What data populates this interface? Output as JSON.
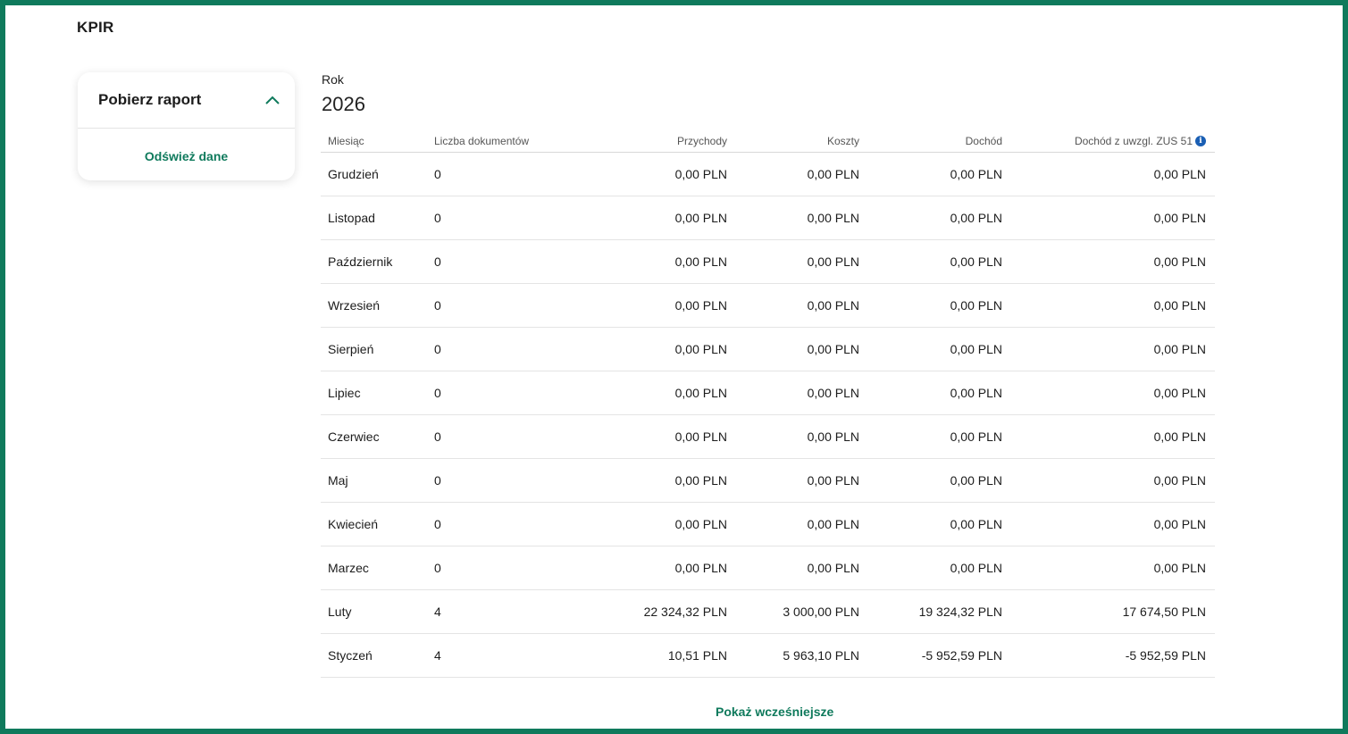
{
  "page": {
    "title": "KPIR"
  },
  "report_card": {
    "title": "Pobierz raport",
    "refresh_label": "Odśwież dane"
  },
  "year": {
    "label": "Rok",
    "value": "2026"
  },
  "table": {
    "headers": [
      "Miesiąc",
      "Liczba dokumentów",
      "Przychody",
      "Koszty",
      "Dochód",
      "Dochód z uwzgl. ZUS 51"
    ],
    "rows": [
      [
        "Grudzień",
        "0",
        "0,00 PLN",
        "0,00 PLN",
        "0,00 PLN",
        "0,00 PLN"
      ],
      [
        "Listopad",
        "0",
        "0,00 PLN",
        "0,00 PLN",
        "0,00 PLN",
        "0,00 PLN"
      ],
      [
        "Październik",
        "0",
        "0,00 PLN",
        "0,00 PLN",
        "0,00 PLN",
        "0,00 PLN"
      ],
      [
        "Wrzesień",
        "0",
        "0,00 PLN",
        "0,00 PLN",
        "0,00 PLN",
        "0,00 PLN"
      ],
      [
        "Sierpień",
        "0",
        "0,00 PLN",
        "0,00 PLN",
        "0,00 PLN",
        "0,00 PLN"
      ],
      [
        "Lipiec",
        "0",
        "0,00 PLN",
        "0,00 PLN",
        "0,00 PLN",
        "0,00 PLN"
      ],
      [
        "Czerwiec",
        "0",
        "0,00 PLN",
        "0,00 PLN",
        "0,00 PLN",
        "0,00 PLN"
      ],
      [
        "Maj",
        "0",
        "0,00 PLN",
        "0,00 PLN",
        "0,00 PLN",
        "0,00 PLN"
      ],
      [
        "Kwiecień",
        "0",
        "0,00 PLN",
        "0,00 PLN",
        "0,00 PLN",
        "0,00 PLN"
      ],
      [
        "Marzec",
        "0",
        "0,00 PLN",
        "0,00 PLN",
        "0,00 PLN",
        "0,00 PLN"
      ],
      [
        "Luty",
        "4",
        "22 324,32 PLN",
        "3 000,00 PLN",
        "19 324,32 PLN",
        "17 674,50 PLN"
      ],
      [
        "Styczeń",
        "4",
        "10,51 PLN",
        "5 963,10 PLN",
        "-5 952,59 PLN",
        "-5 952,59 PLN"
      ]
    ]
  },
  "footer": {
    "show_more_label": "Pokaż wcześniejsze"
  },
  "icons": {
    "collapse": "chevron-up-icon",
    "info": "info-icon"
  },
  "colors": {
    "accent": "#0f7a5c",
    "info": "#1a5fb4"
  }
}
